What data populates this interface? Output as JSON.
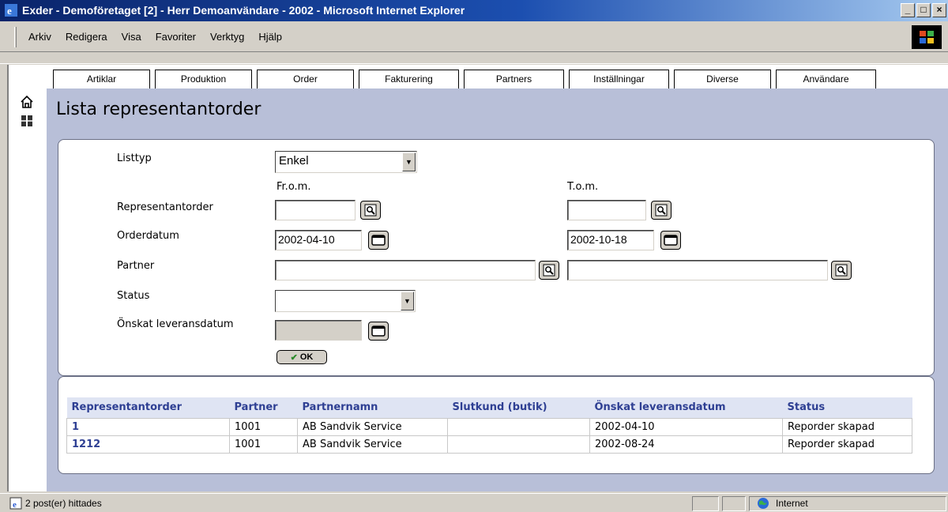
{
  "window": {
    "title": "Exder - Demoföretaget [2] - Herr Demoanvändare - 2002 - Microsoft Internet Explorer",
    "min_glyph": "_",
    "max_glyph": "□",
    "close_glyph": "×"
  },
  "menu": [
    "Arkiv",
    "Redigera",
    "Visa",
    "Favoriter",
    "Verktyg",
    "Hjälp"
  ],
  "tabs": [
    "Artiklar",
    "Produktion",
    "Order",
    "Fakturering",
    "Partners",
    "Inställningar",
    "Diverse",
    "Användare"
  ],
  "page": {
    "title": "Lista representantorder"
  },
  "form": {
    "listtyp_label": "Listtyp",
    "listtyp_value": "Enkel",
    "from_header": "Fr.o.m.",
    "to_header": "T.o.m.",
    "representantorder_label": "Representantorder",
    "representantorder_from": "",
    "representantorder_to": "",
    "orderdatum_label": "Orderdatum",
    "orderdatum_from": "2002-04-10",
    "orderdatum_to": "2002-10-18",
    "partner_label": "Partner",
    "partner_from": "",
    "partner_to": "",
    "status_label": "Status",
    "status_value": "",
    "onskat_label": "Önskat leveransdatum",
    "onskat_value": "",
    "ok_label": "OK",
    "ok_check": "✔"
  },
  "results": {
    "columns": [
      "Representantorder",
      "Partner",
      "Partnernamn",
      "Slutkund (butik)",
      "Önskat leveransdatum",
      "Status"
    ],
    "rows": [
      [
        "1",
        "1001",
        "AB Sandvik Service",
        "",
        "2002-04-10",
        "Reporder skapad"
      ],
      [
        "1212",
        "1001",
        "AB Sandvik Service",
        "",
        "2002-08-24",
        "Reporder skapad"
      ]
    ]
  },
  "status": {
    "message": "2 post(er) hittades",
    "zone": "Internet"
  },
  "colors": {
    "content_bg": "#b8bfd8",
    "header_text": "#2e3f93",
    "header_bg": "#dfe4f3"
  }
}
